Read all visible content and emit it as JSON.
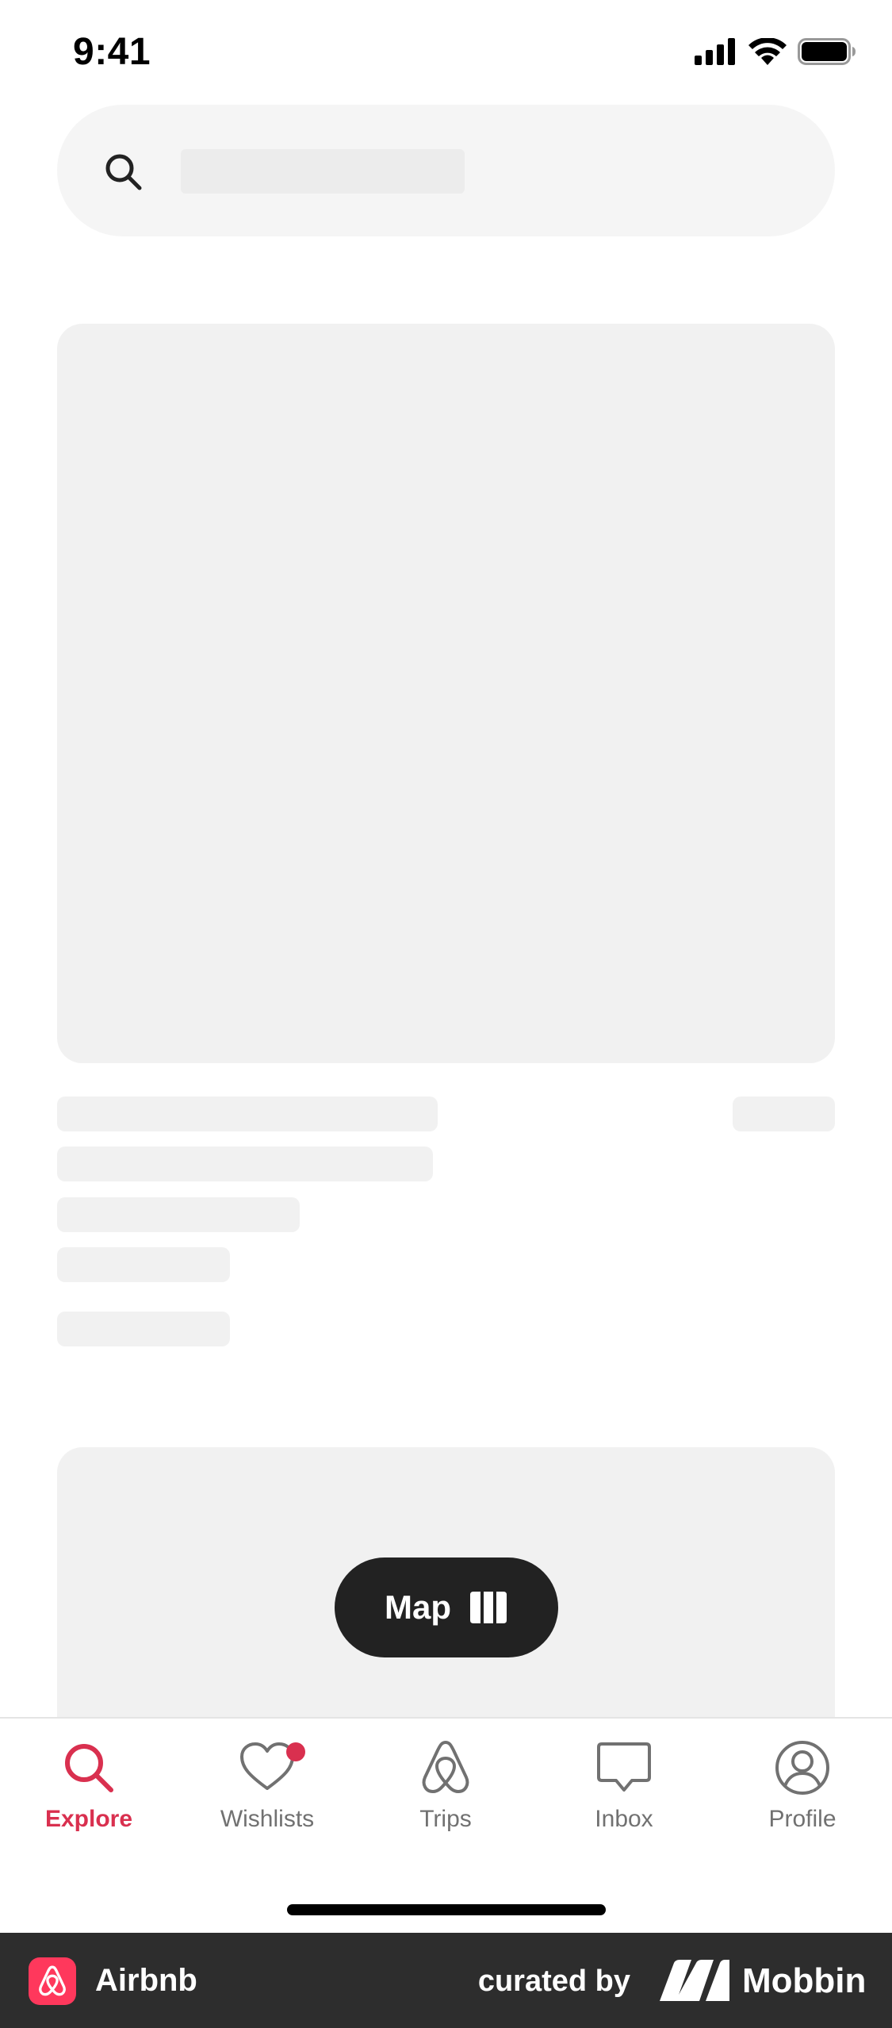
{
  "status_bar": {
    "time": "9:41"
  },
  "search": {
    "icon": "search-icon"
  },
  "map_button": {
    "label": "Map",
    "icon": "map-icon"
  },
  "tabs": [
    {
      "label": "Explore",
      "icon": "search-icon",
      "active": true
    },
    {
      "label": "Wishlists",
      "icon": "heart-icon",
      "active": false,
      "has_notification": true
    },
    {
      "label": "Trips",
      "icon": "airbnb-logo-icon",
      "active": false
    },
    {
      "label": "Inbox",
      "icon": "message-icon",
      "active": false
    },
    {
      "label": "Profile",
      "icon": "user-circle-icon",
      "active": false
    }
  ],
  "footer": {
    "app_name": "Airbnb",
    "curated_by": "curated by",
    "brand": "Mobbin"
  },
  "colors": {
    "accent": "#d9304f",
    "skeleton": "#f1f1f1",
    "map_button_bg": "#222222",
    "footer_bg": "#2d2d2d"
  }
}
